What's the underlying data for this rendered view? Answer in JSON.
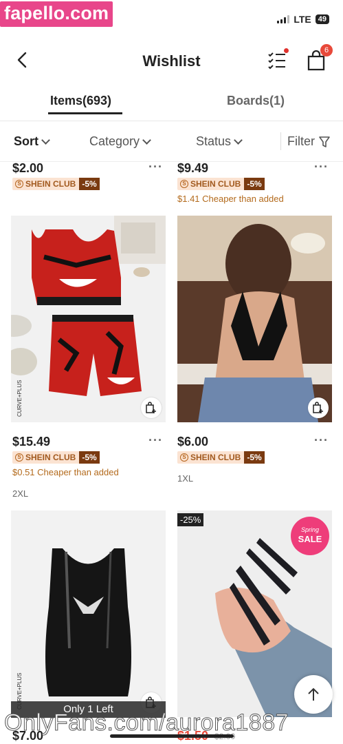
{
  "watermark": {
    "top": "fapello.com",
    "bottom": "OnlyFans.com/aurora1887"
  },
  "status_bar": {
    "network": "LTE",
    "battery": "49"
  },
  "header": {
    "title": "Wishlist",
    "cart_count": "6"
  },
  "tabs": [
    {
      "label": "Items(693)",
      "active": true
    },
    {
      "label": "Boards(1)",
      "active": false
    }
  ],
  "filters": {
    "sort": "Sort",
    "category": "Category",
    "status": "Status",
    "filter": "Filter"
  },
  "products": [
    {
      "price": "$2.00",
      "club_label": "SHEIN CLUB",
      "club_discount": "-5%",
      "cheaper": "",
      "size": ""
    },
    {
      "price": "$9.49",
      "club_label": "SHEIN CLUB",
      "club_discount": "-5%",
      "cheaper": "$1.41 Cheaper than added",
      "size": ""
    },
    {
      "price": "$15.49",
      "club_label": "SHEIN CLUB",
      "club_discount": "-5%",
      "cheaper": "$0.51 Cheaper than added",
      "size": "2XL",
      "brand_tag": "CURVE+PLUS"
    },
    {
      "price": "$6.00",
      "club_label": "SHEIN CLUB",
      "club_discount": "-5%",
      "cheaper": "",
      "size": "1XL"
    },
    {
      "price": "$7.00",
      "stock_label": "Only 1 Left",
      "brand_tag": "CURVE+PLUS"
    },
    {
      "price": "$1.50",
      "old_price": "$2.00",
      "discount_tag": "-25%",
      "sale_badge_top": "Spring",
      "sale_badge": "SALE"
    }
  ],
  "colors": {
    "accent_red": "#e8493a",
    "club_bg": "#fbe3d2",
    "club_text": "#a25a1f",
    "club_discount_bg": "#7a3a10",
    "cheaper_text": "#b36a1c",
    "watermark_pink": "#e8468a"
  },
  "icons": [
    "back-arrow-icon",
    "checklist-icon",
    "shopping-bag-icon",
    "chevron-down-icon",
    "filter-funnel-icon",
    "more-dots-icon",
    "add-to-cart-icon",
    "scroll-top-arrow-icon",
    "shein-club-icon"
  ]
}
